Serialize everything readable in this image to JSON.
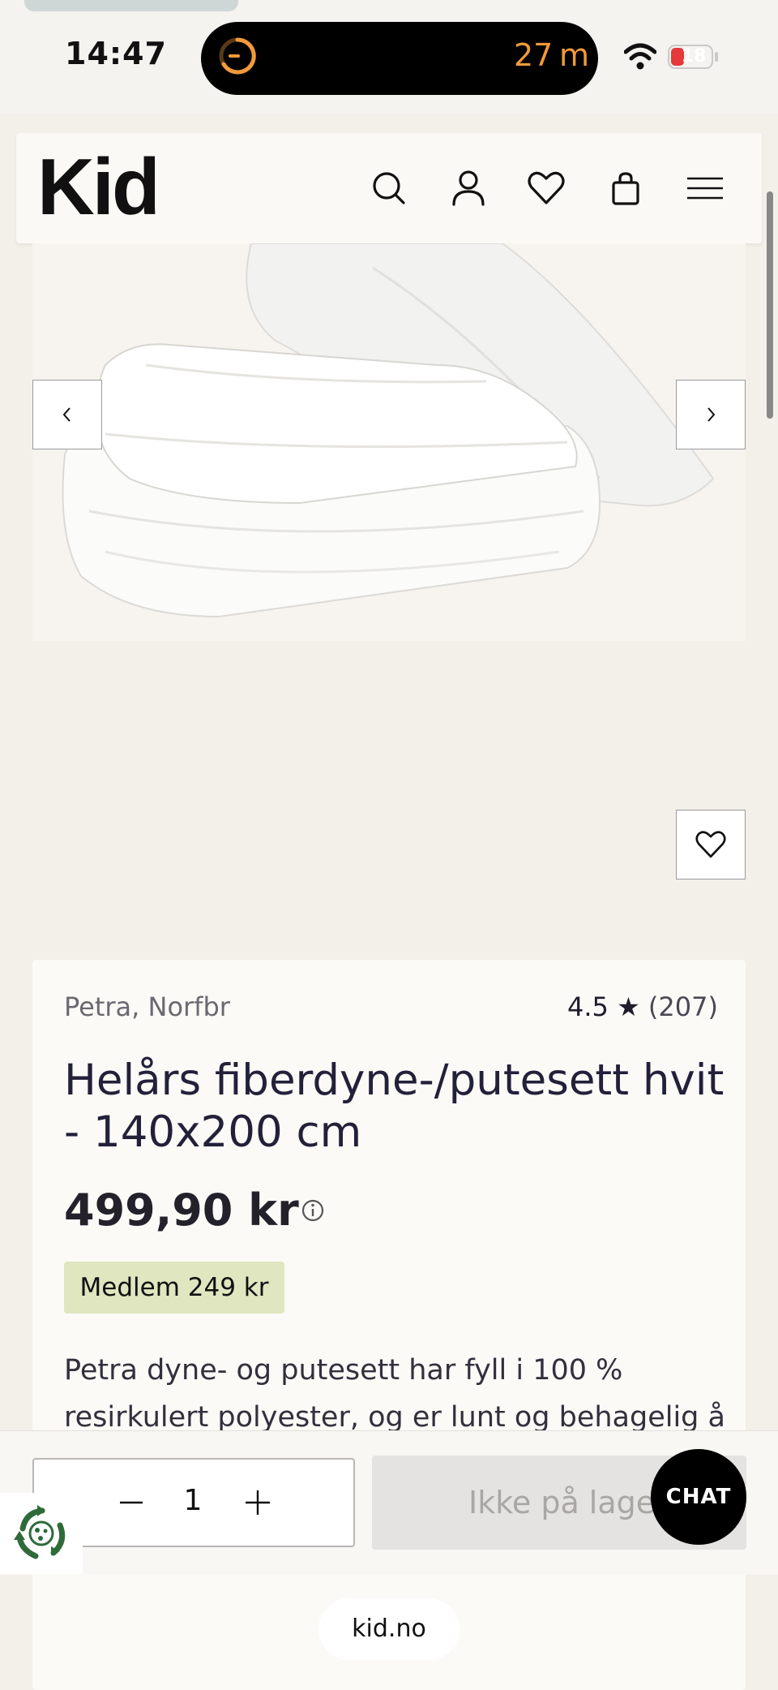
{
  "status_bar": {
    "time": "14:47",
    "activity": "27 m",
    "battery": "18",
    "icons": [
      "timer-icon",
      "wifi-icon",
      "battery-icon"
    ]
  },
  "header": {
    "logo": "Kid",
    "icons": [
      "search-icon",
      "account-icon",
      "wishlist-icon",
      "cart-icon",
      "menu-icon"
    ]
  },
  "product": {
    "brand": "Petra, Norfbr",
    "rating": "4.5",
    "rating_count": "(207)",
    "title": "Helårs fiberdyne-/putesett hvit - 140x200 cm",
    "price": "499,90 kr",
    "member_price": "Medlem 249 kr",
    "description": "Petra dyne- og putesett har fyll i 100 % resirkulert polyester, og er lunt og behagelig å"
  },
  "purchase": {
    "quantity": "1",
    "stock_label": "Ikke på lager",
    "chat_label": "CHAT"
  },
  "browser": {
    "url": "kid.no"
  },
  "colors": {
    "page_bg": "#f3efe9",
    "member_badge": "#dfe6c0",
    "timer_accent": "#f39a3a",
    "battery_low": "#e5393b"
  }
}
